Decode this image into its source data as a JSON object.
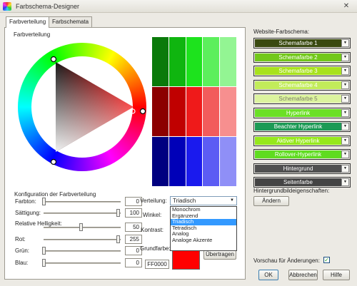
{
  "window": {
    "title": "Farbschema-Designer",
    "close_glyph": "✕"
  },
  "tabs": [
    {
      "label": "Farbverteilung",
      "active": true
    },
    {
      "label": "Farbschemata",
      "active": false
    }
  ],
  "wheel_section": {
    "label": "Farbverteilung"
  },
  "swatch_colors": [
    "#0a7a0a",
    "#0fb50f",
    "#1de31d",
    "#5cef5c",
    "#93f593",
    "#8c0000",
    "#c00000",
    "#ef1a1a",
    "#f25b5b",
    "#f78f8f",
    "#000080",
    "#0000b8",
    "#1a1aee",
    "#5c5cf4",
    "#8f8ff7"
  ],
  "config": {
    "label": "Konfiguration der Farbverteilung",
    "sliders": [
      {
        "label": "Farbton:",
        "value": "0",
        "level": 0
      },
      {
        "label": "Sättigung:",
        "value": "100",
        "level": 1
      },
      {
        "label": "Relative Helligkeit:",
        "value": "50",
        "level": 0.5
      },
      {
        "label": "Rot:",
        "value": "255",
        "level": 1
      },
      {
        "label": "Grün:",
        "value": "0",
        "level": 0
      },
      {
        "label": "Blau:",
        "value": "0",
        "level": 0
      }
    ],
    "distribution_label": "Verteilung:",
    "distribution_value": "Triadisch",
    "distribution_options": [
      "Monochrom",
      "Ergänzend",
      "Triadisch",
      "Tetradisch",
      "Analog",
      "Analoge Akzente"
    ],
    "angle_label": "Winkel:",
    "contrast_label": "Kontrast:",
    "base_color_label": "Grundfarbe:",
    "base_color_hex": "FF0000",
    "base_color": "#ff0000",
    "apply_label": "Übertragen"
  },
  "website": {
    "label": "Website-Farbschema:",
    "rows": [
      {
        "label": "Schemafarbe 1",
        "color": "#3a4a10",
        "text_color": "#ffffff"
      },
      {
        "label": "Schemafarbe 2",
        "color": "#72c81a",
        "text_color": "#ffffff"
      },
      {
        "label": "Schemafarbe 3",
        "color": "#a8e21c",
        "text_color": "#ffffff"
      },
      {
        "label": "Schemafarbe 4",
        "color": "#c2ec5a",
        "text_color": "#ffffff"
      },
      {
        "label": "Schemafarbe 5",
        "color": "#dcf49e",
        "text_color": "#7b7b6b"
      },
      {
        "label": "Hyperlink",
        "color": "#6be026",
        "text_color": "#ffffff"
      },
      {
        "label": "Beachter Hyperlink",
        "color": "#1c9a55",
        "text_color": "#ffffff"
      },
      {
        "label": "Aktiver Hyperlink",
        "color": "#96e81c",
        "text_color": "#ffffff"
      },
      {
        "label": "Rollover-Hyperlink",
        "color": "#5fdc20",
        "text_color": "#ffffff"
      },
      {
        "label": "Hintergrund",
        "color": "#505050",
        "text_color": "#ffffff"
      },
      {
        "label": "Seitenfarbe",
        "color": "#444444",
        "text_color": "#ffffff"
      }
    ],
    "background_label": "Hintergrundbildeigenschaften:",
    "change_label": "Ändern",
    "preview_label": "Vorschau für Änderungen:",
    "preview_checked": true,
    "check_glyph": "✓",
    "dropdown_glyph": "▼"
  },
  "footer": {
    "ok": "OK",
    "cancel": "Abbrechen",
    "help": "Hilfe"
  }
}
